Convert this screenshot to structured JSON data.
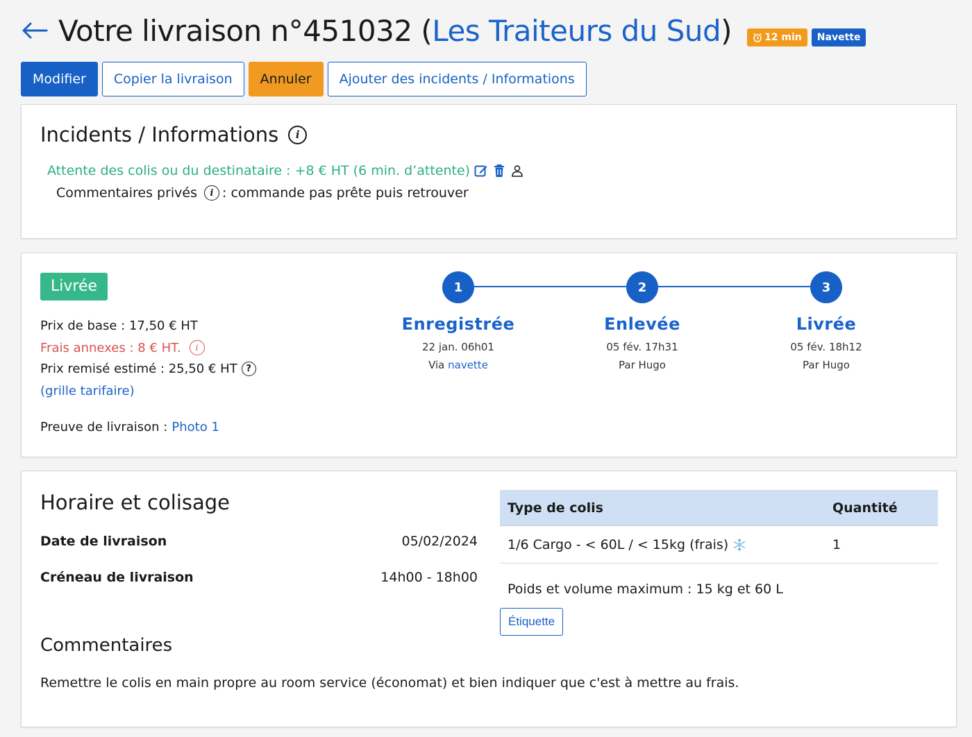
{
  "header": {
    "title_prefix": "Votre livraison n°451032 (",
    "client": "Les Traiteurs du Sud",
    "title_suffix": ")",
    "badge_time": "12 min",
    "badge_shuttle": "Navette"
  },
  "actions": {
    "edit": "Modifier",
    "copy": "Copier la livraison",
    "cancel": "Annuler",
    "add_incident": "Ajouter des incidents / Informations"
  },
  "incidents": {
    "title": "Incidents / Informations",
    "items": [
      {
        "text": "Attente des colis ou du destinataire : +8 € HT (6 min. d’attente)",
        "comment_label": "Commentaires privés",
        "comment_text": ": commande pas prête puis retrouver"
      }
    ]
  },
  "status": {
    "label": "Livrée",
    "base_price": "Prix de base : 17,50 € HT",
    "fees": "Frais annexes : 8 € HT.",
    "estimated": "Prix remisé estimé : 25,50 € HT",
    "grid_link": "(grille tarifaire)",
    "proof_label": "Preuve de livraison : ",
    "proof_link": "Photo 1",
    "steps": [
      {
        "num": "1",
        "name": "Enregistrée",
        "date": "22 jan. 06h01",
        "by_prefix": "Via ",
        "by_link": "navette"
      },
      {
        "num": "2",
        "name": "Enlevée",
        "date": "05 fév. 17h31",
        "by_prefix": "Par Hugo",
        "by_link": ""
      },
      {
        "num": "3",
        "name": "Livrée",
        "date": "05 fév. 18h12",
        "by_prefix": "Par Hugo",
        "by_link": ""
      }
    ]
  },
  "schedule": {
    "title": "Horaire et colisage",
    "date_label": "Date de livraison",
    "date_value": "05/02/2024",
    "slot_label": "Créneau de livraison",
    "slot_value": "14h00 - 18h00",
    "comments_title": "Commentaires",
    "comments_text": "Remettre le colis en main propre au room service (économat) et bien indiquer que c'est à mettre au frais.",
    "table": {
      "headers": [
        "Type de colis",
        "Quantité"
      ],
      "rows": [
        {
          "type": "1/6 Cargo - < 60L / < 15kg (frais)",
          "qty": "1"
        }
      ]
    },
    "max_note": "Poids et volume maximum : 15 kg et 60 L",
    "label_button": "Étiquette"
  },
  "colors": {
    "primary": "#1760c6",
    "success": "#36b88a",
    "warning": "#f09a22",
    "danger": "#d9534f",
    "incident_green": "#2eb07c"
  }
}
